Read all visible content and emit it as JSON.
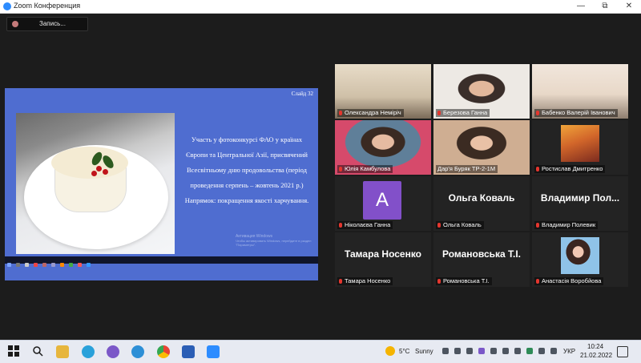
{
  "window": {
    "title": "Zoom Конференция",
    "minimize": "—",
    "maximize": "⧉",
    "close": "✕"
  },
  "recording": {
    "label": "Запись..."
  },
  "slide": {
    "number": "Слайд 32",
    "lines": [
      "Участь у фотоконкурсі ФАО у країнах",
      "Європи та Центральної Азії, присвячений",
      "Всесвітньому дню продовольства (період",
      "проведення серпень  – жовтень 2021 р.)",
      "Напрямок: покращення якості харчування."
    ],
    "watermark_title": "Активация Windows",
    "watermark_sub": "Чтобы активировать Windows, перейдите в раздел \"Параметры\"."
  },
  "participants": [
    {
      "name": "Олександра Немірiч",
      "kind": "video"
    },
    {
      "name": "Березова Ганна",
      "kind": "video"
    },
    {
      "name": "Бабенко Валерій Іванович",
      "kind": "video"
    },
    {
      "name": "Юлія  Камбулова",
      "kind": "video"
    },
    {
      "name": "Дар'я Буряк ТР-2-1М",
      "kind": "video",
      "active": true
    },
    {
      "name": "Ростислав Дмитренко",
      "kind": "photo"
    },
    {
      "name": "Ніколаєва Ганна",
      "kind": "avatar",
      "initial": "A"
    },
    {
      "name": "Ольга Коваль",
      "kind": "text",
      "big": "Ольга Коваль"
    },
    {
      "name": "Владимир Полевик",
      "kind": "text",
      "big": "Владимир  Пол..."
    },
    {
      "name": "Тамара Носенко",
      "kind": "text",
      "big": "Тамара Носенко"
    },
    {
      "name": "Романовська Т.І.",
      "kind": "text",
      "big": "Романовська Т.І."
    },
    {
      "name": "Анастасія Воробйова",
      "kind": "photo"
    }
  ],
  "taskbar": {
    "weather_temp": "5°C",
    "weather_text": "Sunny",
    "language": "УКР",
    "time": "10:24",
    "date": "21.02.2022"
  },
  "colors": {
    "slide_bg": "#4f6dd0",
    "active_speaker": "#c7e35b",
    "avatar_purple": "#8250c9"
  }
}
